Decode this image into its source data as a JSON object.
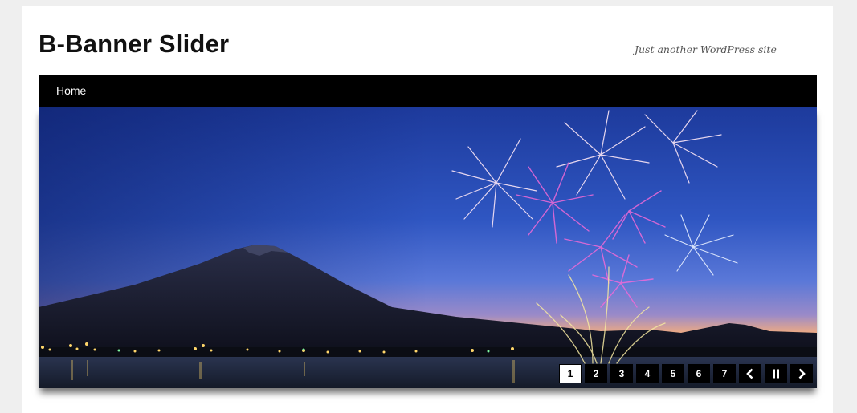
{
  "site": {
    "title": "B-Banner Slider",
    "tagline": "Just another WordPress site"
  },
  "nav": {
    "items": [
      {
        "label": "Home"
      }
    ]
  },
  "slider": {
    "image": "night-fireworks-over-mountain-lake",
    "pager": {
      "pages": [
        "1",
        "2",
        "3",
        "4",
        "5",
        "6",
        "7"
      ],
      "active_page": "1",
      "controls": [
        "chevron-left-icon",
        "pause-icon",
        "chevron-right-icon"
      ]
    }
  },
  "colors": {
    "page_background": "#efefef",
    "content_background": "#ffffff",
    "nav_background": "#000000",
    "pager_button": "#000000",
    "pager_active": "#ffffff"
  }
}
